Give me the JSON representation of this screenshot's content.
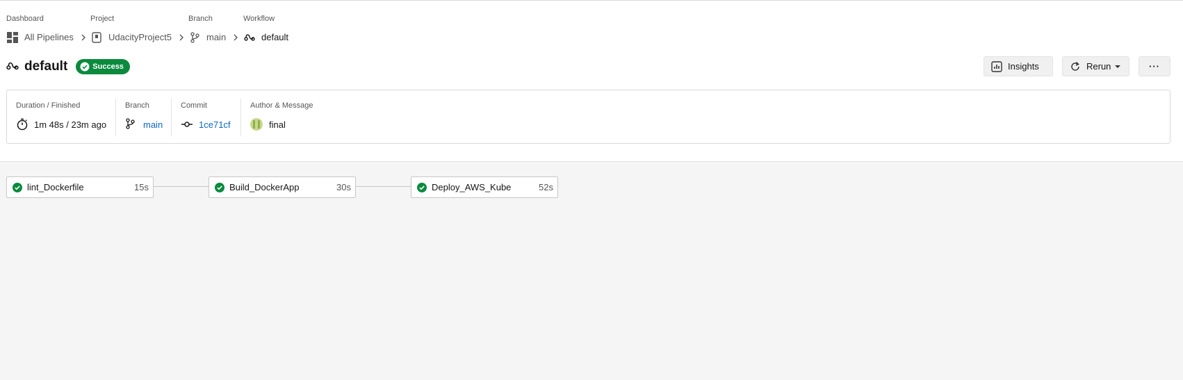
{
  "breadcrumb": {
    "dashboard": {
      "label": "Dashboard",
      "value": "All Pipelines"
    },
    "project": {
      "label": "Project",
      "value": "UdacityProject5"
    },
    "branch": {
      "label": "Branch",
      "value": "main"
    },
    "workflow": {
      "label": "Workflow",
      "value": "default"
    }
  },
  "header": {
    "title": "default",
    "status": "Success",
    "insights_label": "Insights",
    "rerun_label": "Rerun",
    "more_label": "···"
  },
  "info": {
    "duration": {
      "label": "Duration / Finished",
      "value": "1m 48s / 23m ago"
    },
    "branch": {
      "label": "Branch",
      "value": "main"
    },
    "commit": {
      "label": "Commit",
      "value": "1ce71cf"
    },
    "author": {
      "label": "Author & Message",
      "value": "final"
    }
  },
  "jobs": [
    {
      "name": "lint_Dockerfile",
      "duration": "15s",
      "status": "success"
    },
    {
      "name": "Build_DockerApp",
      "duration": "30s",
      "status": "success"
    },
    {
      "name": "Deploy_AWS_Kube",
      "duration": "52s",
      "status": "success"
    }
  ],
  "colors": {
    "success": "#0b8a3e",
    "link": "#0967c4",
    "canvas": "#f5f5f5"
  },
  "icons": {
    "dashboard": "dashboard-icon",
    "project": "project-icon",
    "branch": "branch-icon",
    "workflow": "workflow-icon",
    "success": "check-circle-icon",
    "insights": "insights-icon",
    "rerun": "rerun-icon",
    "timer": "timer-icon",
    "commit": "commit-icon"
  }
}
